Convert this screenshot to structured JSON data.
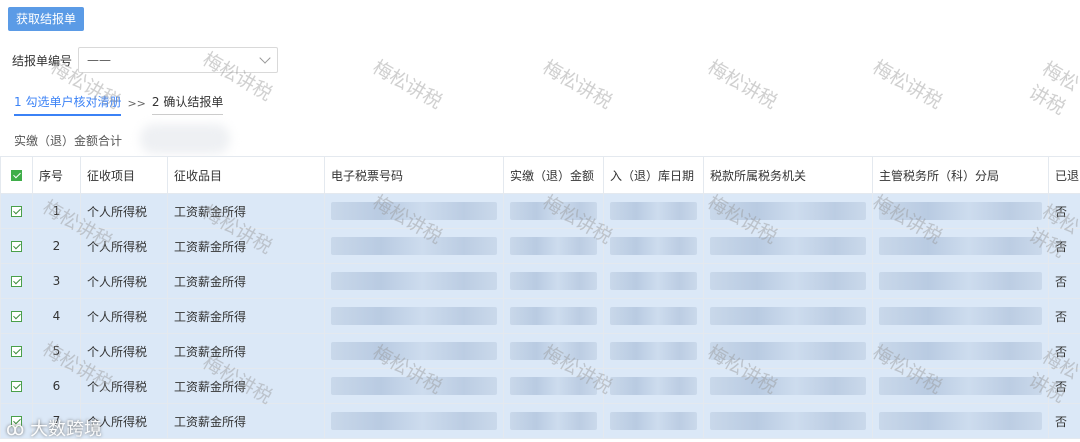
{
  "toolbar": {
    "fetch_label": "获取结报单"
  },
  "form": {
    "number_label": "结报单编号",
    "number_value": "——"
  },
  "steps": [
    {
      "label": "1 勾选单户核对清册"
    },
    {
      "label": "2 确认结报单"
    }
  ],
  "step_separator": ">>",
  "total_label": "实缴（退）金额合计",
  "table": {
    "headers": [
      "序号",
      "征收项目",
      "征收品目",
      "电子税票号码",
      "实缴（退）金额",
      "入（退）库日期",
      "税款所属税务机关",
      "主管税务所（科）分局",
      "已退"
    ],
    "rows": [
      {
        "index": "1",
        "item": "个人所得税",
        "category": "工资薪金所得",
        "returned": "否"
      },
      {
        "index": "2",
        "item": "个人所得税",
        "category": "工资薪金所得",
        "returned": "否"
      },
      {
        "index": "3",
        "item": "个人所得税",
        "category": "工资薪金所得",
        "returned": "否"
      },
      {
        "index": "4",
        "item": "个人所得税",
        "category": "工资薪金所得",
        "returned": "否"
      },
      {
        "index": "5",
        "item": "个人所得税",
        "category": "工资薪金所得",
        "returned": "否"
      },
      {
        "index": "6",
        "item": "个人所得税",
        "category": "工资薪金所得",
        "returned": "否"
      },
      {
        "index": "7",
        "item": "个人所得税",
        "category": "工资薪金所得",
        "returned": "否"
      }
    ]
  },
  "watermark": "梅松讲税",
  "logo": "大数跨境"
}
